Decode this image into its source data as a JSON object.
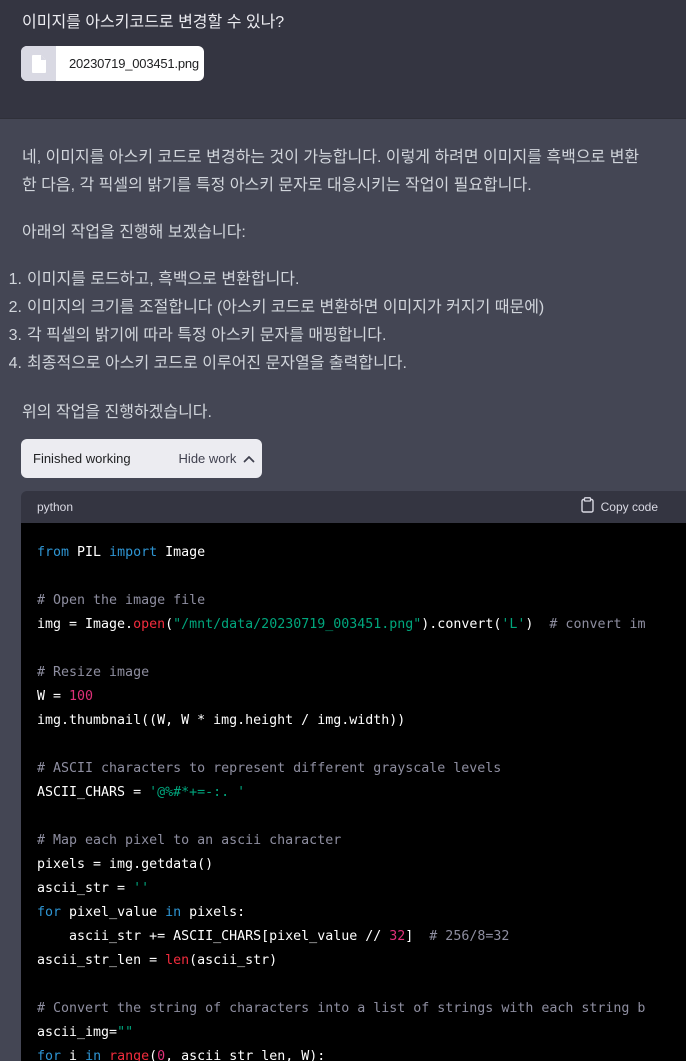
{
  "user_message": {
    "text": "이미지를 아스키코드로 변경할 수 있나?",
    "attachment": {
      "filename": "20230719_003451.png",
      "icon": "file-icon"
    }
  },
  "assistant": {
    "para1_line1": "네, 이미지를 아스키 코드로 변경하는 것이 가능합니다. 이렇게 하려면 이미지를 흑백으로 변환",
    "para1_line2": "한 다음, 각 픽셀의 밝기를 특정 아스키 문자로 대응시키는 작업이 필요합니다.",
    "para2": "아래의 작업을 진행해 보겠습니다:",
    "steps": [
      {
        "num": "1.",
        "text": "이미지를 로드하고, 흑백으로 변환합니다."
      },
      {
        "num": "2.",
        "text": "이미지의 크기를 조절합니다 (아스키 코드로 변환하면 이미지가 커지기 때문에)"
      },
      {
        "num": "3.",
        "text": "각 픽셀의 밝기에 따라 특정 아스키 문자를 매핑합니다."
      },
      {
        "num": "4.",
        "text": "최종적으로 아스키 코드로 이루어진 문자열을 출력합니다."
      }
    ],
    "para3": "위의 작업을 진행하겠습니다.",
    "work_toggle": {
      "status": "Finished working",
      "hide_label": "Hide work",
      "icon": "chevron-up-icon"
    },
    "code": {
      "language": "python",
      "copy_label": "Copy code",
      "copy_icon": "clipboard-icon",
      "lines": [
        "from PIL import Image",
        "",
        "# Open the image file",
        "img = Image.open(\"/mnt/data/20230719_003451.png\").convert('L')  # convert im",
        "",
        "# Resize image",
        "W = 100",
        "img.thumbnail((W, W * img.height / img.width))",
        "",
        "# ASCII characters to represent different grayscale levels",
        "ASCII_CHARS = '@%#*+=-:. '",
        "",
        "# Map each pixel to an ascii character",
        "pixels = img.getdata()",
        "ascii_str = ''",
        "for pixel_value in pixels:",
        "    ascii_str += ASCII_CHARS[pixel_value // 32]  # 256/8=32",
        "ascii_str_len = len(ascii_str)",
        "",
        "# Convert the string of characters into a list of strings with each string b",
        "ascii_img=\"\"",
        "for i in range(0, ascii_str_len, W):"
      ]
    },
    "colors": {
      "keyword": "#2e95d3",
      "string": "#00a67d",
      "number": "#df3079",
      "builtin": "#f22c3d",
      "comment": "#8e8ea0"
    }
  }
}
